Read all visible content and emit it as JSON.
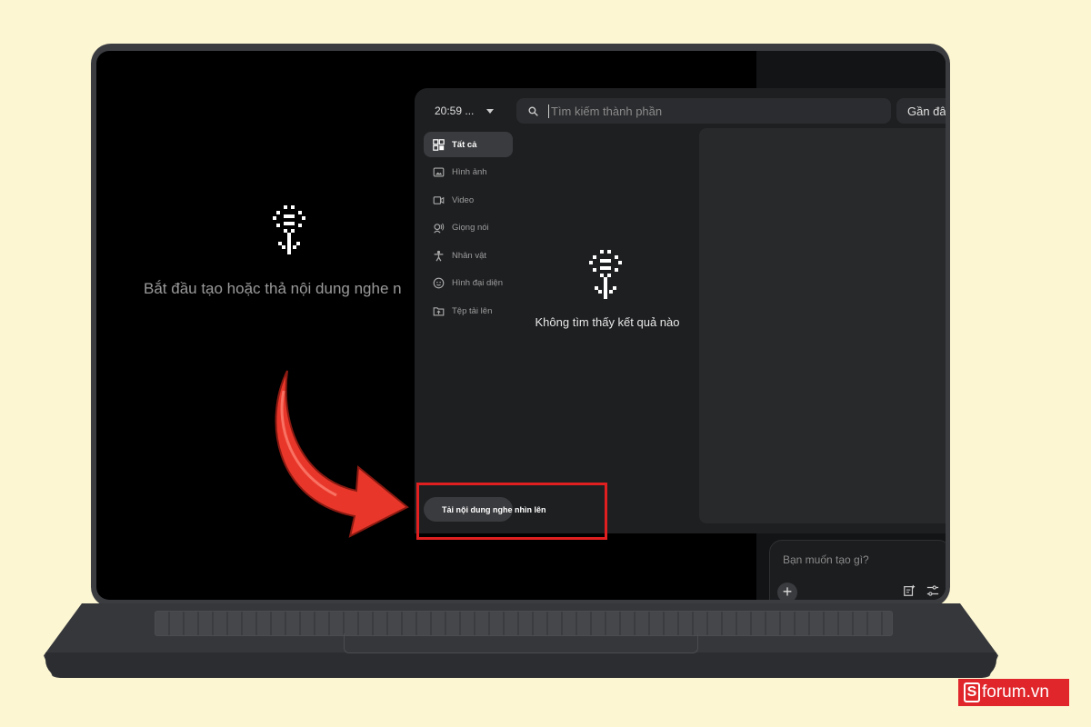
{
  "empty_state": {
    "message": "Bắt đầu tạo hoặc thả nội dung nghe n"
  },
  "panel": {
    "time_select": "20:59 ...",
    "search": {
      "placeholder": "Tìm kiếm thành phần"
    },
    "recent_button": "Gần đây",
    "sidebar": {
      "items": [
        {
          "label": "Tất cả",
          "icon": "grid-icon",
          "active": true
        },
        {
          "label": "Hình ảnh",
          "icon": "image-icon"
        },
        {
          "label": "Video",
          "icon": "video-icon"
        },
        {
          "label": "Giọng nói",
          "icon": "voice-icon"
        },
        {
          "label": "Nhân vật",
          "icon": "person-icon"
        },
        {
          "label": "Hình đại diện",
          "icon": "avatar-icon"
        },
        {
          "label": "Tệp tải lên",
          "icon": "folder-upload-icon"
        }
      ]
    },
    "no_results": "Không tìm thấy kết quả nào",
    "upload_button": "Tải nội dung nghe nhìn lên"
  },
  "prompt": {
    "placeholder": "Bạn muốn tạo gì?"
  },
  "watermark": {
    "logo_letter": "S",
    "text": "forum.vn"
  },
  "colors": {
    "highlight": "#e02020",
    "arrow": "#e8372a",
    "background": "#fdf6d3"
  }
}
